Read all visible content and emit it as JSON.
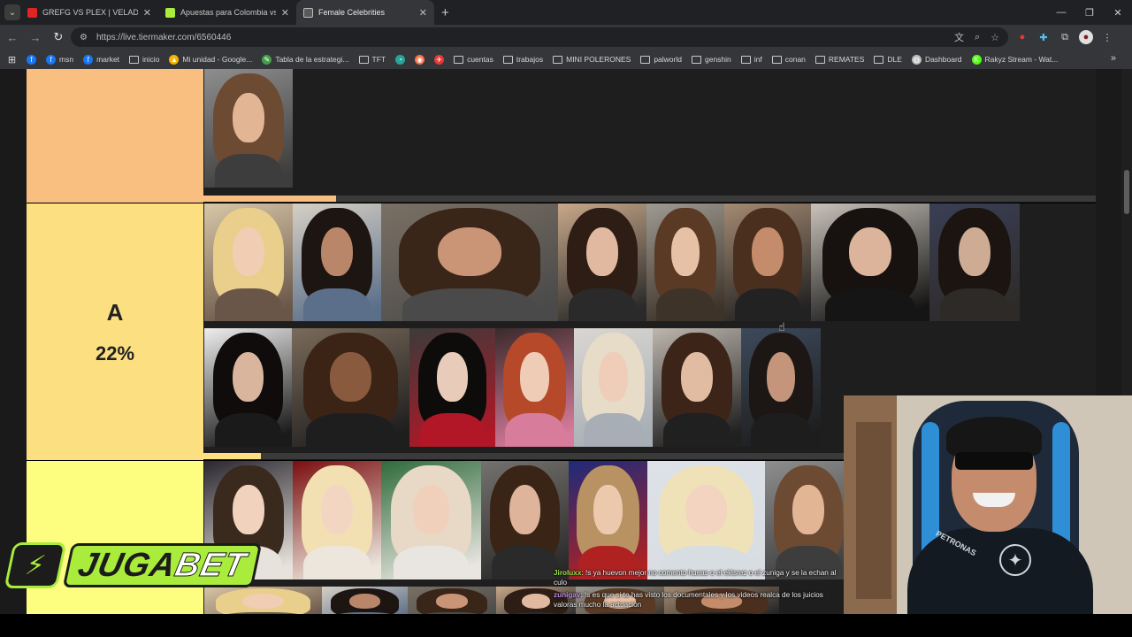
{
  "browser": {
    "tabs": [
      {
        "title": "GREFG VS PLEX | VELADA DEL AÑO",
        "favicon_color": "#e02424",
        "active": false
      },
      {
        "title": "Apuestas para Colombia vs Francia",
        "favicon_color": "#a9ec3b",
        "active": false
      },
      {
        "title": "Female Celebrities",
        "favicon_color": "#bdbdbd",
        "active": true
      }
    ],
    "new_tab": "+",
    "url": "https://live.tiermaker.com/6560446",
    "bookmarks": [
      {
        "label": "",
        "kind": "fb"
      },
      {
        "label": "msn",
        "kind": "fb"
      },
      {
        "label": "market",
        "kind": "fb"
      },
      {
        "label": "inicio",
        "kind": "folder"
      },
      {
        "label": "Mi unidad - Google...",
        "kind": "drive"
      },
      {
        "label": "Tabla de la estrategi...",
        "kind": "leaf"
      },
      {
        "label": "TFT",
        "kind": "folder"
      },
      {
        "label": "",
        "kind": "tft"
      },
      {
        "label": "",
        "kind": "orange"
      },
      {
        "label": "",
        "kind": "red"
      },
      {
        "label": "cuentas",
        "kind": "folder"
      },
      {
        "label": "trabajos",
        "kind": "folder"
      },
      {
        "label": "MINI POLERONES",
        "kind": "folder"
      },
      {
        "label": "palworld",
        "kind": "folder"
      },
      {
        "label": "genshin",
        "kind": "folder"
      },
      {
        "label": "inf",
        "kind": "folder"
      },
      {
        "label": "conan",
        "kind": "folder"
      },
      {
        "label": "REMATES",
        "kind": "folder"
      },
      {
        "label": "DLE",
        "kind": "folder"
      },
      {
        "label": "Dashboard",
        "kind": "globe"
      },
      {
        "label": "Rakyz Stream - Wat...",
        "kind": "kick"
      }
    ]
  },
  "tiers": [
    {
      "id": "tier-s",
      "letter": "",
      "percent": "",
      "color": "#f9bf80"
    },
    {
      "id": "tier-a",
      "letter": "A",
      "percent": "22%",
      "color": "#fbdf80"
    },
    {
      "id": "tier-b",
      "letter": "",
      "percent": "",
      "color": "#fdfd80"
    }
  ],
  "overlay": {
    "brand_left": "JUGA",
    "brand_right": "BET",
    "chat": [
      {
        "user": "Jiroluxx",
        "text": ": !s ya huevon mejor no comento hueas o el ekisrez o el zuniga y se la echan al culo",
        "user_color": "#9be24a"
      },
      {
        "user": "zunigav",
        "text": ": !s es que si te has visto los documentales y los videos realca de los juicios valoras mucho la actuación",
        "user_color": "#c08ae8"
      }
    ]
  },
  "palette": {
    "page_bg": "#1a1a1a",
    "tier_item_bg": "#1e1e1e",
    "accent_green": "#a9ec3b"
  }
}
